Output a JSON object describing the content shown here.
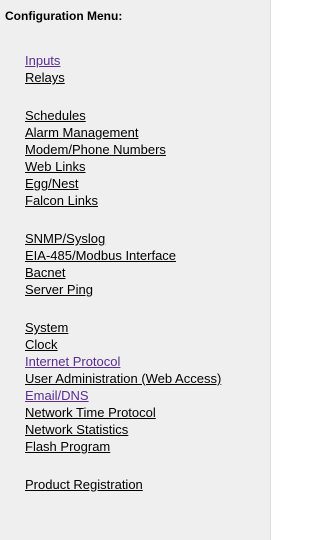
{
  "menu": {
    "title": "Configuration Menu:",
    "groups": [
      {
        "items": [
          {
            "label": "Inputs",
            "visited": true
          },
          {
            "label": "Relays",
            "visited": false
          }
        ]
      },
      {
        "items": [
          {
            "label": "Schedules",
            "visited": false
          },
          {
            "label": "Alarm Management",
            "visited": false
          },
          {
            "label": "Modem/Phone Numbers",
            "visited": false
          },
          {
            "label": "Web Links",
            "visited": false
          },
          {
            "label": "Egg/Nest",
            "visited": false
          },
          {
            "label": "Falcon Links",
            "visited": false
          }
        ]
      },
      {
        "items": [
          {
            "label": "SNMP/Syslog",
            "visited": false
          },
          {
            "label": "EIA-485/Modbus Interface",
            "visited": false
          },
          {
            "label": "Bacnet",
            "visited": false
          },
          {
            "label": "Server Ping",
            "visited": false
          }
        ]
      },
      {
        "items": [
          {
            "label": "System",
            "visited": false
          },
          {
            "label": "Clock",
            "visited": false
          },
          {
            "label": "Internet Protocol",
            "visited": true
          },
          {
            "label": "User Administration (Web Access)",
            "visited": false
          },
          {
            "label": "Email/DNS",
            "visited": true
          },
          {
            "label": "Network Time Protocol",
            "visited": false
          },
          {
            "label": "Network Statistics",
            "visited": false
          },
          {
            "label": "Flash Program",
            "visited": false
          }
        ]
      },
      {
        "items": [
          {
            "label": "Product Registration",
            "visited": false
          }
        ]
      }
    ]
  },
  "colors": {
    "background": "#efefef",
    "link": "#000000",
    "visited_link": "#5a2d8f"
  }
}
